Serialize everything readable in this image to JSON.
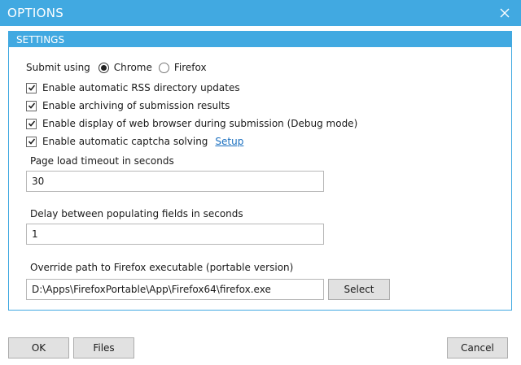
{
  "window": {
    "title": "OPTIONS"
  },
  "settings": {
    "header": "SETTINGS",
    "submit": {
      "label": "Submit using",
      "options": [
        "Chrome",
        "Firefox"
      ],
      "selected": "Chrome"
    },
    "checkboxes": [
      {
        "label": "Enable automatic RSS directory updates",
        "checked": true
      },
      {
        "label": "Enable archiving of submission results",
        "checked": true
      },
      {
        "label": "Enable display of web browser during submission (Debug mode)",
        "checked": true
      },
      {
        "label": "Enable automatic captcha solving",
        "checked": true,
        "link": "Setup"
      }
    ],
    "timeout": {
      "label": "Page load timeout in seconds",
      "value": "30"
    },
    "delay": {
      "label": "Delay between populating fields in seconds",
      "value": "1"
    },
    "firefox_path": {
      "label": "Override path to Firefox executable (portable version)",
      "value": "D:\\Apps\\FirefoxPortable\\App\\Firefox64\\firefox.exe",
      "button": "Select"
    }
  },
  "footer": {
    "ok": "OK",
    "files": "Files",
    "cancel": "Cancel"
  },
  "colors": {
    "accent": "#41a9e1",
    "link": "#1a6fbf"
  }
}
